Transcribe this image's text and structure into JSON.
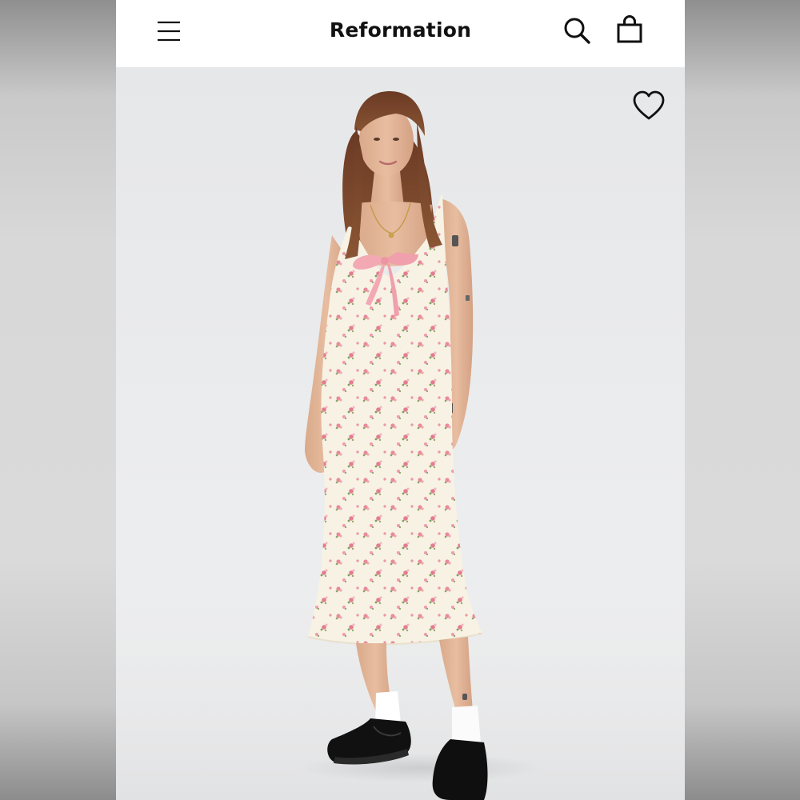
{
  "header": {
    "brand": "Reformation",
    "menu_icon": "hamburger-menu-icon",
    "search_icon": "search-icon",
    "bag_icon": "shopping-bag-icon"
  },
  "product": {
    "wishlist_icon": "heart-outline-icon",
    "image_alt_colors": {
      "dress": "#f6f1e3",
      "bow": "#f3a9b3",
      "floral_pink": "#e88a9a",
      "floral_green": "#8aa36a",
      "shoes": "#111111",
      "socks": "#ffffff"
    }
  },
  "colors": {
    "topbar_bg": "#ffffff",
    "text": "#111111",
    "photo_bg": "#e9eaec"
  }
}
